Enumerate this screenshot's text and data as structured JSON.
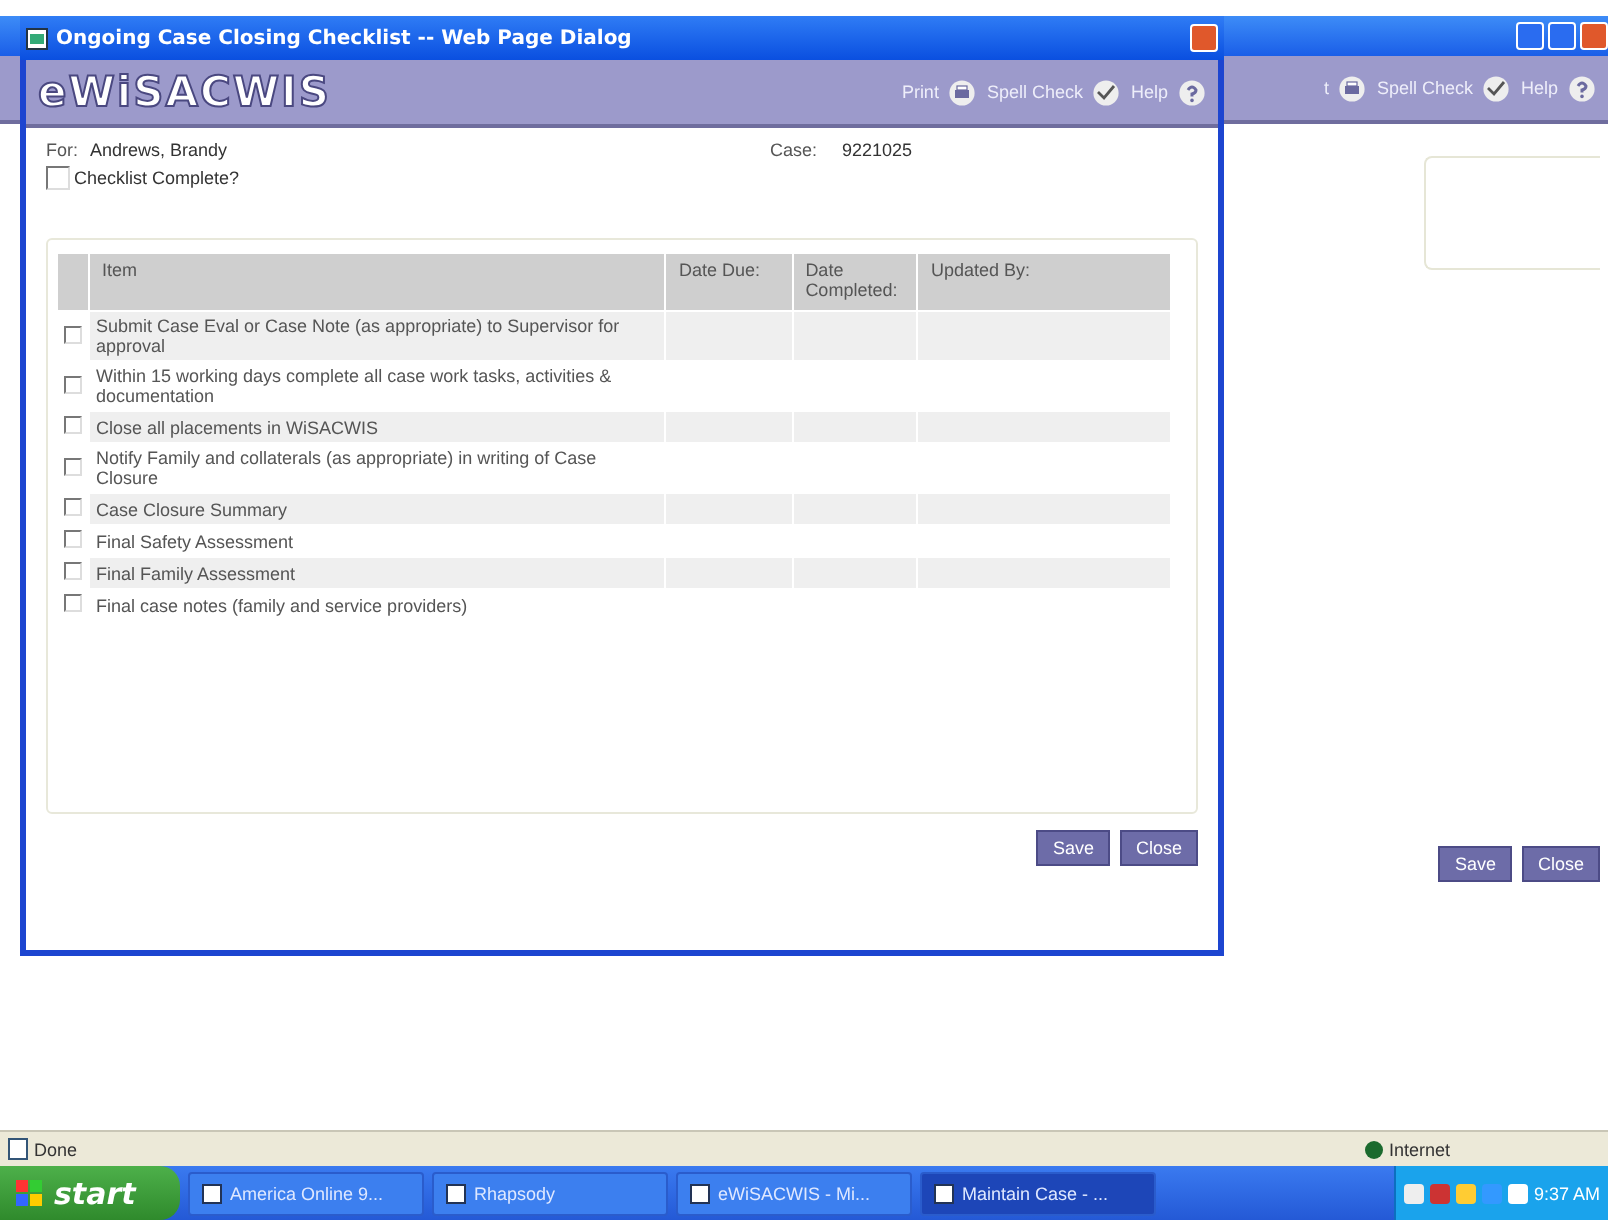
{
  "background_window": {
    "toolbar": [
      {
        "label": "t",
        "kind": "print"
      },
      {
        "label": "Spell Check",
        "kind": "spell"
      },
      {
        "label": "Help",
        "kind": "help"
      }
    ],
    "buttons": [
      "Save",
      "Close"
    ]
  },
  "dialog": {
    "title": "Ongoing Case Closing Checklist -- Web Page Dialog",
    "logo": "eWiSACWIS",
    "toolbar": [
      {
        "label": "Print",
        "kind": "print"
      },
      {
        "label": "Spell Check",
        "kind": "spell"
      },
      {
        "label": "Help",
        "kind": "help"
      }
    ],
    "for_label": "For:",
    "for_value": "Andrews, Brandy",
    "case_label": "Case:",
    "case_value": "9221025",
    "checklist_complete": {
      "label": "Checklist Complete?",
      "checked": false
    },
    "table": {
      "columns": [
        "Item",
        "Date Due:",
        "Date Completed:",
        "Updated By:"
      ],
      "rows": [
        {
          "item": "Submit Case Eval or Case Note (as appropriate) to Supervisor for approval",
          "checked": false
        },
        {
          "item": "Within 15 working days complete all case work tasks, activities & documentation",
          "checked": false
        },
        {
          "item": "Close all placements in WiSACWIS",
          "checked": false
        },
        {
          "item": "Notify Family and collaterals (as appropriate) in writing of Case Closure",
          "checked": false
        },
        {
          "item": "Case Closure Summary",
          "checked": false
        },
        {
          "item": "Final Safety Assessment",
          "checked": false
        },
        {
          "item": "Final Family Assessment",
          "checked": false
        },
        {
          "item": "Final case notes (family and service providers)",
          "checked": false
        }
      ]
    },
    "buttons": [
      "Save",
      "Close"
    ]
  },
  "status_bar": {
    "status": "Done",
    "zone": "Internet"
  },
  "taskbar": {
    "start": "start",
    "tasks": [
      {
        "label": "America Online 9...",
        "selected": false
      },
      {
        "label": "Rhapsody",
        "selected": false
      },
      {
        "label": "eWiSACWIS - Mi...",
        "selected": false
      },
      {
        "label": "Maintain Case - ...",
        "selected": true
      }
    ],
    "clock": "9:37 AM"
  }
}
